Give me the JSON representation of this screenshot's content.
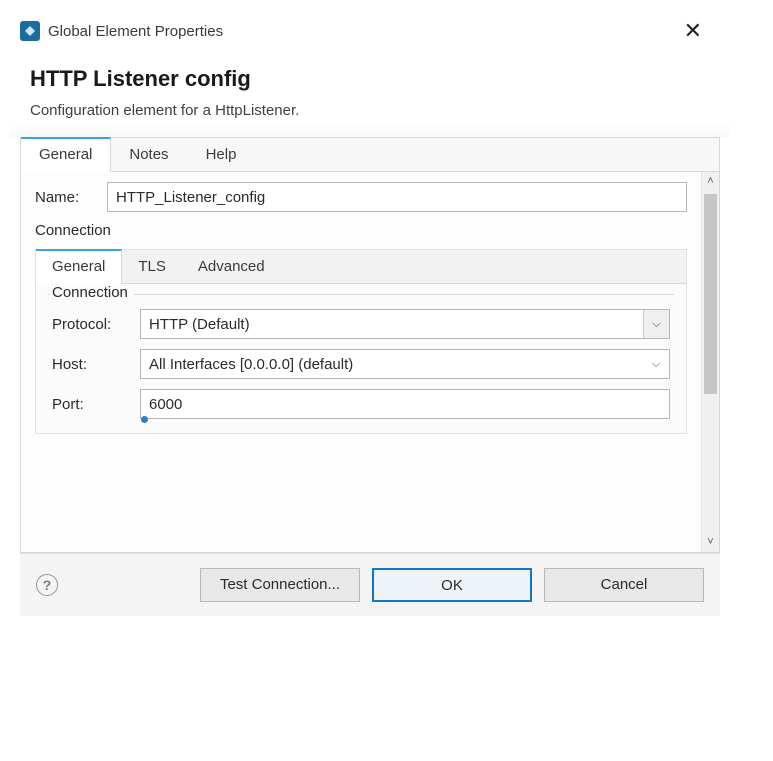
{
  "window": {
    "title": "Global Element Properties"
  },
  "header": {
    "title": "HTTP Listener config",
    "subtitle": "Configuration element for a HttpListener."
  },
  "main_tabs": [
    {
      "label": "General",
      "active": true
    },
    {
      "label": "Notes",
      "active": false
    },
    {
      "label": "Help",
      "active": false
    }
  ],
  "form": {
    "name_label": "Name:",
    "name_value": "HTTP_Listener_config",
    "connection_section_label": "Connection"
  },
  "inner_tabs": [
    {
      "label": "General",
      "active": true
    },
    {
      "label": "TLS",
      "active": false
    },
    {
      "label": "Advanced",
      "active": false
    }
  ],
  "connection_fieldset": {
    "legend": "Connection",
    "protocol_label": "Protocol:",
    "protocol_value": "HTTP (Default)",
    "host_label": "Host:",
    "host_value": "All Interfaces [0.0.0.0] (default)",
    "port_label": "Port:",
    "port_value": "6000"
  },
  "buttons": {
    "test_connection": "Test Connection...",
    "ok": "OK",
    "cancel": "Cancel"
  },
  "glyphs": {
    "close": "✕",
    "chev_down": "⌵",
    "caret_up": "˄",
    "caret_down": "˅",
    "question": "?"
  }
}
